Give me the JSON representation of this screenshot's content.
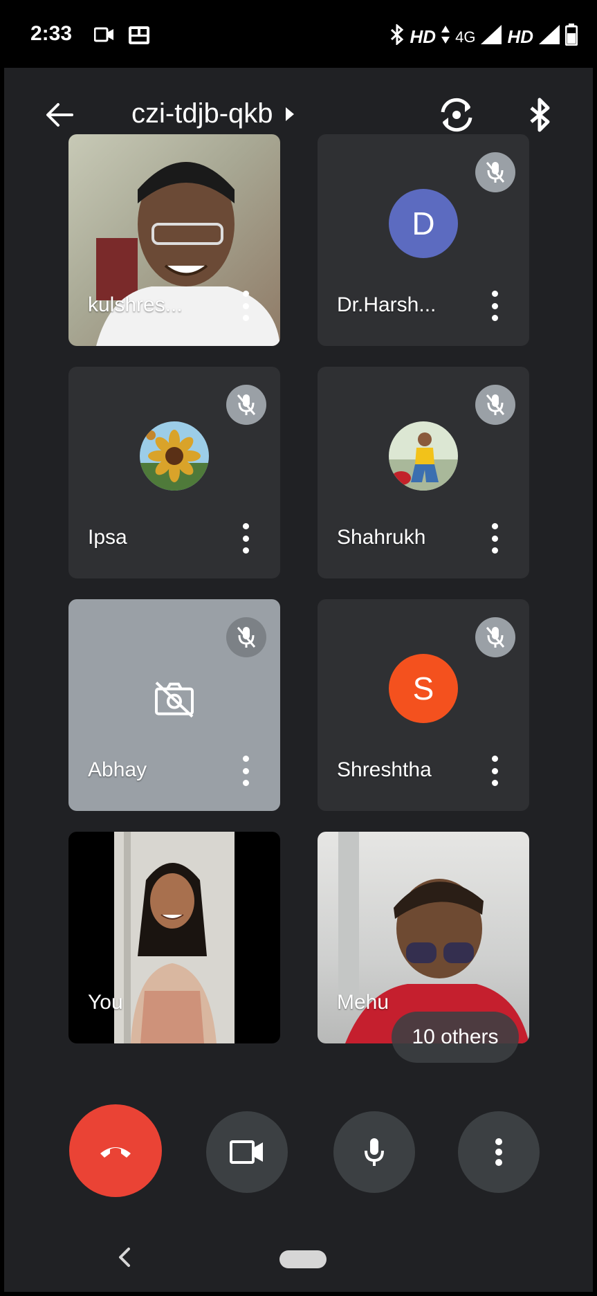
{
  "status_bar": {
    "time": "2:33",
    "left_icons": [
      "video-camera-icon",
      "meet-badge-icon"
    ],
    "right_items": [
      "bluetooth-icon",
      "HD",
      "data-arrows-icon",
      "4G",
      "signal-icon",
      "HD",
      "signal-icon",
      "battery-icon"
    ],
    "hd_1": "HD",
    "net_label": "4G",
    "hd_2": "HD"
  },
  "top_bar": {
    "meeting_code": "czi-tdjb-qkb",
    "icons": [
      "back-arrow-icon",
      "caret-right-icon",
      "switch-camera-icon",
      "bluetooth-icon"
    ]
  },
  "participants": [
    {
      "name": "kulshres...",
      "type": "video",
      "muted": false
    },
    {
      "name": "Dr.Harsh...",
      "type": "letter",
      "initial": "D",
      "color": "#5c6bc0",
      "muted": true
    },
    {
      "name": "Ipsa",
      "type": "photo",
      "muted": true
    },
    {
      "name": "Shahrukh",
      "type": "photo",
      "muted": true
    },
    {
      "name": "Abhay",
      "type": "camera-off",
      "muted": true
    },
    {
      "name": "Shreshtha",
      "type": "letter",
      "initial": "S",
      "color": "#f4511e",
      "muted": true
    },
    {
      "name": "You",
      "type": "video",
      "muted": false
    },
    {
      "name": "Mehu",
      "type": "video",
      "muted": false
    }
  ],
  "others_pill": "10 others",
  "controls": {
    "end_call": "end-call-icon",
    "camera": "video-camera-icon",
    "mic": "microphone-icon",
    "more": "more-vert-icon"
  },
  "nav": [
    "nav-back-icon",
    "home-pill"
  ],
  "colors": {
    "background": "#202124",
    "tile": "#3c4043",
    "end_call": "#ea4335",
    "avatar_d": "#5c6bc0",
    "avatar_s": "#f4511e"
  }
}
